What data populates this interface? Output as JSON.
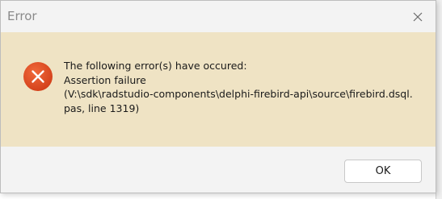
{
  "dialog": {
    "title": "Error",
    "close_icon": "close-icon",
    "icon": "error-icon",
    "message_lines": [
      "The following error(s) have occured:",
      "Assertion failure",
      "(V:\\sdk\\radstudio-components\\delphi-firebird-api\\source\\firebird.dsql.",
      "pas, line 1319)"
    ],
    "ok_label": "OK"
  },
  "colors": {
    "content_background": "#efe3c4",
    "error_icon": "#dd4a22",
    "titlebar": "#f3f3f3"
  }
}
